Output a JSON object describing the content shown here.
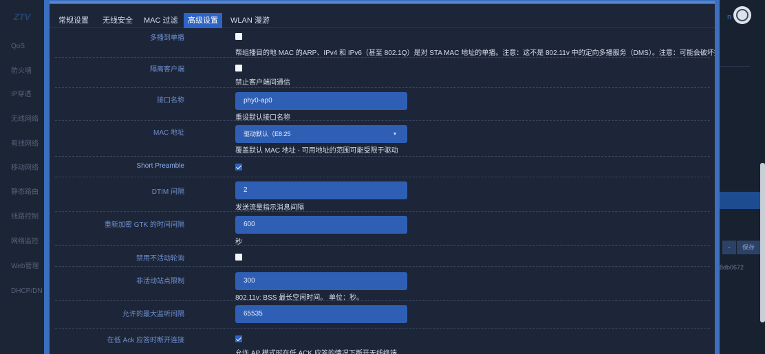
{
  "app": {
    "logo_text": "ZTV",
    "user_text": "n",
    "right_panel": {
      "dropdown_glyph": "-",
      "save_label": "保存",
      "hash_text": "8db0672"
    }
  },
  "sidebar": {
    "items": [
      {
        "label": "QoS"
      },
      {
        "label": "防火墙"
      },
      {
        "label": "IP穿透"
      },
      {
        "label": "无线网络"
      },
      {
        "label": "有线网络"
      },
      {
        "label": "移动网络"
      },
      {
        "label": "静态路由"
      },
      {
        "label": "线路控制"
      },
      {
        "label": "网络监控"
      },
      {
        "label": "Web管理"
      },
      {
        "label": "DHCP/DN"
      }
    ]
  },
  "tabs": [
    {
      "label": "常规设置",
      "active": false
    },
    {
      "label": "无线安全",
      "active": false
    },
    {
      "label": "MAC 过滤",
      "active": false
    },
    {
      "label": "高级设置",
      "active": true
    },
    {
      "label": "WLAN 漫游",
      "active": false
    }
  ],
  "form": {
    "multicast_to_unicast": {
      "label": "多播到单播",
      "checked": false,
      "description": "帮组播目的地 MAC 的ARP、IPv4 和 IPv6（甚至 802.1Q）是对 STA MAC 地址的单播。注意：这不是 802.11v 中的定向多播服务（DMS）。注意：可能会破坏接收端 STA 多播预期。"
    },
    "isolate_clients": {
      "label": "隔离客户端",
      "checked": false,
      "description": "禁止客户端间通信"
    },
    "interface_name": {
      "label": "接口名称",
      "value": "phy0-ap0",
      "description": "重设默认接口名称"
    },
    "mac_address": {
      "label": "MAC 地址",
      "selected": "驱动默认（E8:25",
      "description": "覆盖默认 MAC 地址 - 可用地址的范围可能受限于驱动"
    },
    "short_preamble": {
      "label": "Short Preamble",
      "checked": true
    },
    "dtim_interval": {
      "label": "DTIM 间隔",
      "value": "2",
      "description": "发送流量指示消息间隔"
    },
    "gtk_rekey": {
      "label": "重新加密 GTK 的时间间隔",
      "value": "600",
      "description": "秒"
    },
    "disable_inactivity_poll": {
      "label": "禁用不活动轮询",
      "checked": false
    },
    "inactivity_limit": {
      "label": "非活动站点限制",
      "value": "300",
      "description": "802.11v: BSS 最长空闲时间。 单位：秒。"
    },
    "max_listen_interval": {
      "label": "允许的最大监听间隔",
      "value": "65535"
    },
    "disassoc_low_ack": {
      "label": "在低 Ack 应答时断开连接",
      "checked": true,
      "description": "允许 AP 模式时在低 ACK 应答的情况下断开无线终端"
    }
  }
}
